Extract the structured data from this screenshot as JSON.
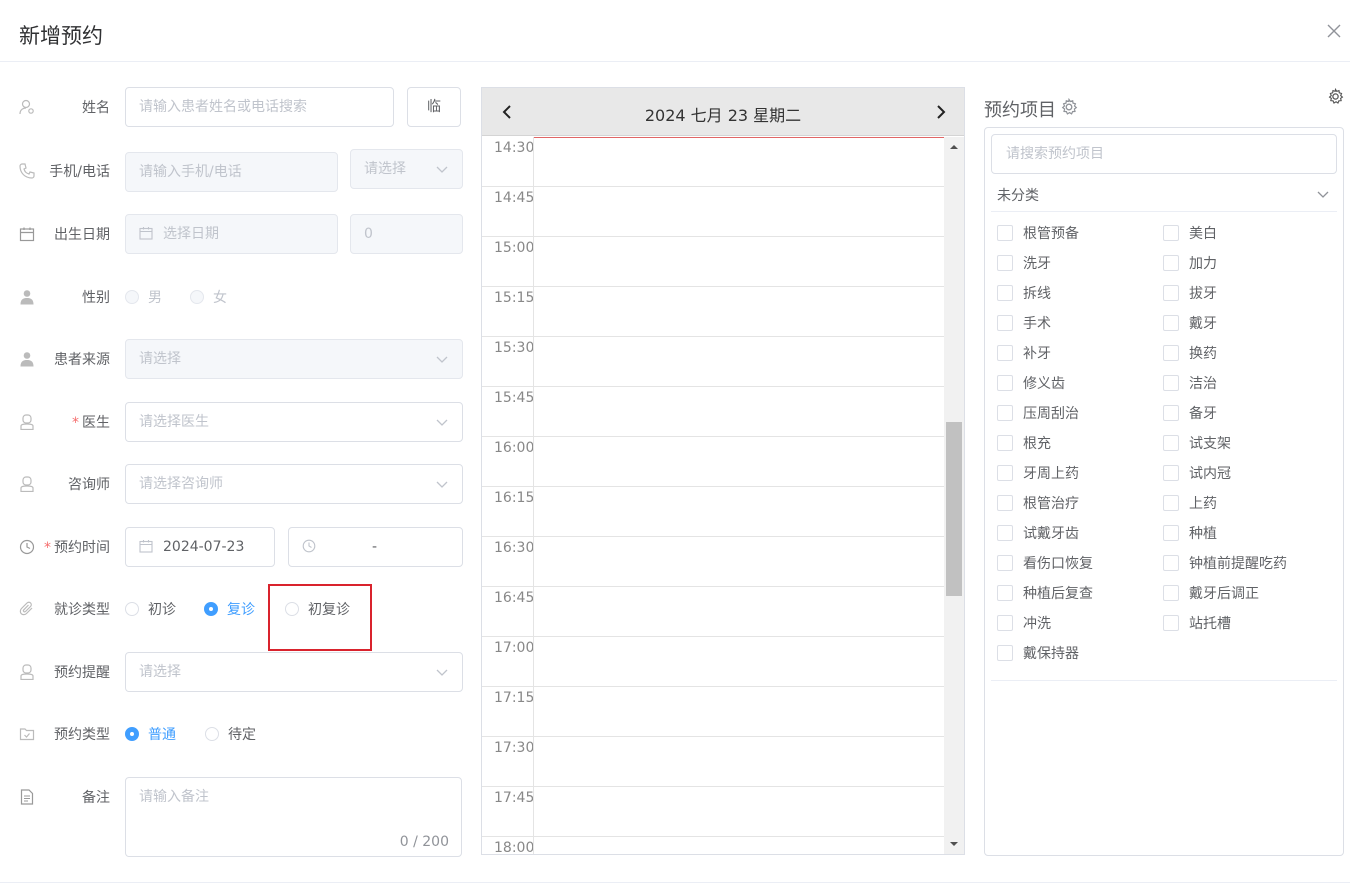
{
  "dialog": {
    "title": "新增预约"
  },
  "form": {
    "name": {
      "label": "姓名",
      "placeholder": "请输入患者姓名或电话搜索",
      "temp_button": "临"
    },
    "phone": {
      "label": "手机/电话",
      "placeholder": "请输入手机/电话",
      "type_select": "请选择"
    },
    "birthday": {
      "label": "出生日期",
      "placeholder": "选择日期",
      "age": "0"
    },
    "gender": {
      "label": "性别",
      "options": [
        "男",
        "女"
      ]
    },
    "source": {
      "label": "患者来源",
      "placeholder": "请选择"
    },
    "doctor": {
      "label": "医生",
      "required_mark": "*",
      "placeholder": "请选择医生"
    },
    "consultant": {
      "label": "咨询师",
      "placeholder": "请选择咨询师"
    },
    "appt_time": {
      "label": "预约时间",
      "required_mark": "*",
      "date": "2024-07-23",
      "time_separator": "-"
    },
    "visit_type": {
      "label": "就诊类型",
      "options": [
        "初诊",
        "复诊",
        "初复诊"
      ],
      "selected": "复诊"
    },
    "reminder": {
      "label": "预约提醒",
      "placeholder": "请选择"
    },
    "appt_type": {
      "label": "预约类型",
      "options": [
        "普通",
        "待定"
      ],
      "selected": "普通"
    },
    "remark": {
      "label": "备注",
      "placeholder": "请输入备注",
      "count": "0 / 200"
    }
  },
  "calendar": {
    "title": "2024 七月 23 星期二",
    "slots": [
      "14:30",
      "14:45",
      "15:00",
      "15:15",
      "15:30",
      "15:45",
      "16:00",
      "16:15",
      "16:30",
      "16:45",
      "17:00",
      "17:15",
      "17:30",
      "17:45",
      "18:00"
    ]
  },
  "items": {
    "title": "预约项目",
    "search_placeholder": "请搜索预约项目",
    "category": "未分类",
    "left": [
      "根管预备",
      "洗牙",
      "拆线",
      "手术",
      "补牙",
      "修义齿",
      "压周刮治",
      "根充",
      "牙周上药",
      "根管治疗",
      "试戴牙齿",
      "看伤口恢复",
      "种植后复查",
      "冲洗",
      "戴保持器"
    ],
    "right": [
      "美白",
      "加力",
      "拔牙",
      "戴牙",
      "换药",
      "洁治",
      "备牙",
      "试支架",
      "试内冠",
      "上药",
      "种植",
      "钟植前提醒吃药",
      "戴牙后调正",
      "站托槽"
    ]
  },
  "colors": {
    "accent": "#409eff",
    "required": "#f56c6c",
    "highlight": "#d9232d",
    "now_line": "#e06666"
  }
}
